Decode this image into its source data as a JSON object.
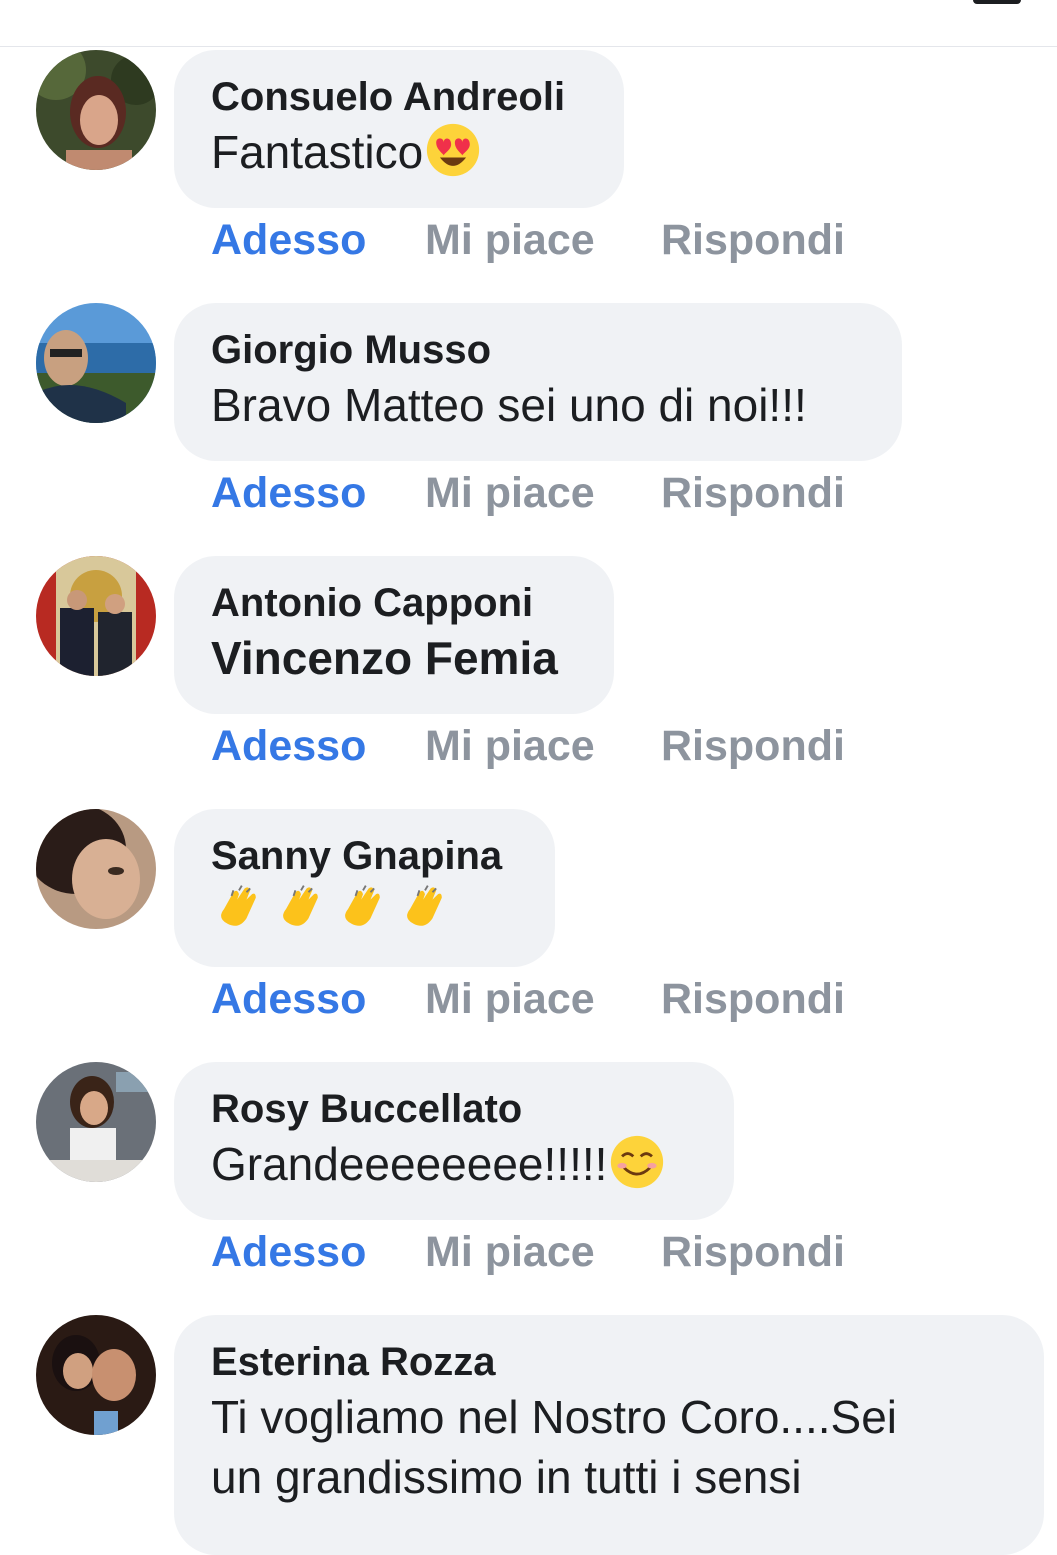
{
  "colors": {
    "bubble_bg": "#f0f2f5",
    "text": "#1c1e21",
    "timestamp": "#3578e5",
    "action": "#8d949e"
  },
  "comments": [
    {
      "author": "Consuelo Andreoli",
      "text": "Fantastico",
      "emoji": "heart-eyes-emoji",
      "time": "Adesso",
      "like": "Mi piace",
      "reply": "Rispondi"
    },
    {
      "author": "Giorgio Musso",
      "text": "Bravo Matteo sei uno di noi!!!",
      "time": "Adesso",
      "like": "Mi piace",
      "reply": "Rispondi"
    },
    {
      "author": "Antonio Capponi",
      "text": "Vincenzo Femia",
      "time": "Adesso",
      "like": "Mi piace",
      "reply": "Rispondi"
    },
    {
      "author": "Sanny Gnapina",
      "text": "",
      "emoji": "clapping-hands-emoji",
      "emoji_count": 4,
      "time": "Adesso",
      "like": "Mi piace",
      "reply": "Rispondi"
    },
    {
      "author": "Rosy Buccellato",
      "text": "Grandeeeeeeee!!!!!",
      "emoji": "smiling-face-emoji",
      "time": "Adesso",
      "like": "Mi piace",
      "reply": "Rispondi"
    },
    {
      "author": "Esterina Rozza",
      "text_line1": "Ti vogliamo nel Nostro Coro....Sei",
      "text_line2": "un grandissimo in tutti i sensi"
    }
  ]
}
